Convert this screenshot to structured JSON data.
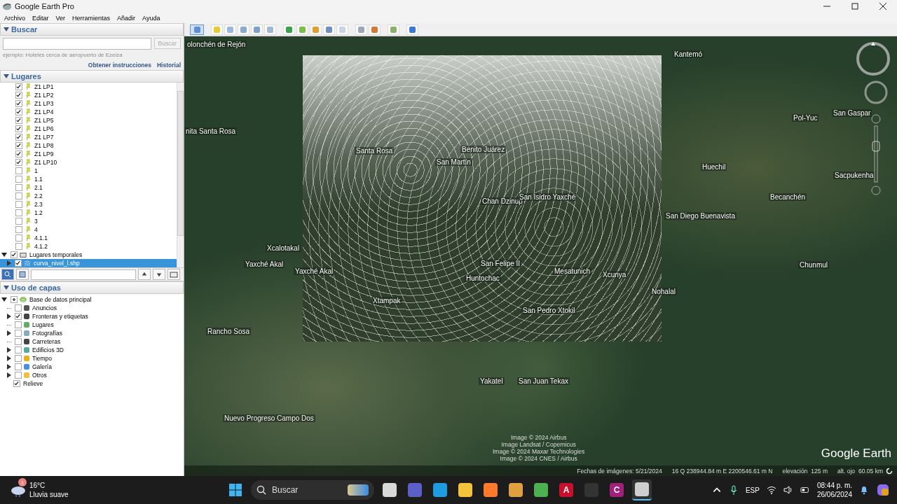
{
  "window": {
    "title": "Google Earth Pro"
  },
  "menu": [
    "Archivo",
    "Editar",
    "Ver",
    "Herramientas",
    "Añadir",
    "Ayuda"
  ],
  "search_panel": {
    "title": "Buscar",
    "expanded": true,
    "button": "Buscar",
    "hint": "ejemplo: Hoteles cerca de aeropuerto de Ezeiza",
    "links": [
      "Obtener instrucciones",
      "Historial"
    ]
  },
  "places_panel": {
    "title": "Lugares",
    "expanded": true,
    "items": [
      {
        "label": "Z1 LP1",
        "checked": true,
        "selected": false
      },
      {
        "label": "Z1 LP2",
        "checked": true,
        "selected": false
      },
      {
        "label": "Z1 LP3",
        "checked": true,
        "selected": false
      },
      {
        "label": "Z1 LP4",
        "checked": true,
        "selected": false
      },
      {
        "label": "Z1 LP5",
        "checked": true,
        "selected": false
      },
      {
        "label": "Z1 LP6",
        "checked": true,
        "selected": false
      },
      {
        "label": "Z1 LP7",
        "checked": true,
        "selected": false
      },
      {
        "label": "Z1 LP8",
        "checked": true,
        "selected": false
      },
      {
        "label": "Z1 LP9",
        "checked": true,
        "selected": false
      },
      {
        "label": "Z1 LP10",
        "checked": true,
        "selected": false
      },
      {
        "label": "1",
        "checked": false,
        "selected": false
      },
      {
        "label": "1.1",
        "checked": false,
        "selected": false
      },
      {
        "label": "2.1",
        "checked": false,
        "selected": false
      },
      {
        "label": "2.2",
        "checked": false,
        "selected": false
      },
      {
        "label": "2.3",
        "checked": false,
        "selected": false
      },
      {
        "label": "1.2",
        "checked": false,
        "selected": false
      },
      {
        "label": "3",
        "checked": false,
        "selected": false
      },
      {
        "label": "4",
        "checked": false,
        "selected": false
      },
      {
        "label": "4.1.1",
        "checked": false,
        "selected": false
      },
      {
        "label": "4.1.2",
        "checked": false,
        "selected": false
      }
    ],
    "folder": {
      "label": "Lugares temporales",
      "checked": true,
      "expanded": true,
      "selected": false,
      "children": [
        {
          "label": "curva_nivel_l.shp",
          "checked": true,
          "expanded": false,
          "selected": true
        }
      ]
    }
  },
  "layers_panel": {
    "title": "Uso de capas",
    "expanded": true,
    "root": {
      "label": "Base de datos principal",
      "partial": true,
      "expanded": true,
      "children": [
        {
          "label": "Anuncios",
          "checked": false,
          "expandable": false
        },
        {
          "label": "Fronteras y etiquetas",
          "checked": true,
          "expandable": true
        },
        {
          "label": "Lugares",
          "checked": false,
          "expandable": false
        },
        {
          "label": "Fotografías",
          "checked": false,
          "expandable": true
        },
        {
          "label": "Carreteras",
          "checked": false,
          "expandable": false
        },
        {
          "label": "Edificios 3D",
          "checked": false,
          "expandable": true
        },
        {
          "label": "Tiempo",
          "checked": false,
          "expandable": true
        },
        {
          "label": "Galería",
          "checked": false,
          "expandable": true
        },
        {
          "label": "Otros",
          "checked": false,
          "expandable": true
        }
      ]
    },
    "extra": {
      "label": "Relieve",
      "checked": true
    }
  },
  "map": {
    "labels": [
      "olonchén de Rejón",
      "Kantemó",
      "nita Santa Rosa",
      "Pol-Yuc",
      "San Gaspar",
      "Huechil",
      "Sacpukenha",
      "Becanchén",
      "San Diego Buenavista",
      "Xcalotakal",
      "Yaxché Akal",
      "Chunmul",
      "Nohalal",
      "Rancho Sosa",
      "Yakatel",
      "San Juan Tekax",
      "Nuevo Progreso Campo Dos"
    ],
    "overlay_labels": [
      "Santa Rosa",
      "Benito Juárez",
      "San Martín",
      "Chan Dzinup",
      "San Isidro Yaxché",
      "Yaxché Akal",
      "San Felipe II",
      "Mesatunich",
      "Xcunya",
      "Huntochac",
      "Xtampak",
      "San Pedro Xtokil"
    ],
    "credits": [
      "Image © 2024 Airbus",
      "Image Landsat / Copernicus",
      "Image © 2024 Maxar Technologies",
      "Image © 2024 CNES / Airbus"
    ],
    "logo": "Google Earth",
    "status": {
      "dates": "Fechas de imágenes: 5/21/2024",
      "coords": "16 Q 238944.84 m E 2200546.61 m N",
      "elevation_label": "elevación",
      "elevation": "125 m",
      "eye_label": "alt. ojo",
      "eye": "60.05 km"
    }
  },
  "taskbar": {
    "weather": {
      "badge": "1",
      "temp": "16°C",
      "desc": "Lluvia suave"
    },
    "search": "Buscar",
    "apps": [
      {
        "kind": "taskview",
        "active": false
      },
      {
        "kind": "teams",
        "active": false
      },
      {
        "kind": "edge",
        "active": false
      },
      {
        "kind": "explorer",
        "active": false
      },
      {
        "kind": "firefox",
        "active": false
      },
      {
        "kind": "davinci",
        "active": false
      },
      {
        "kind": "chrome",
        "active": false
      },
      {
        "kind": "autocad",
        "letter": "A",
        "active": false
      },
      {
        "kind": "obs",
        "active": false
      },
      {
        "kind": "civil",
        "letter": "C",
        "active": false
      },
      {
        "kind": "earth",
        "active": true
      }
    ],
    "language": "ESP",
    "time": "08:44 p. m.",
    "date": "26/06/2024"
  }
}
